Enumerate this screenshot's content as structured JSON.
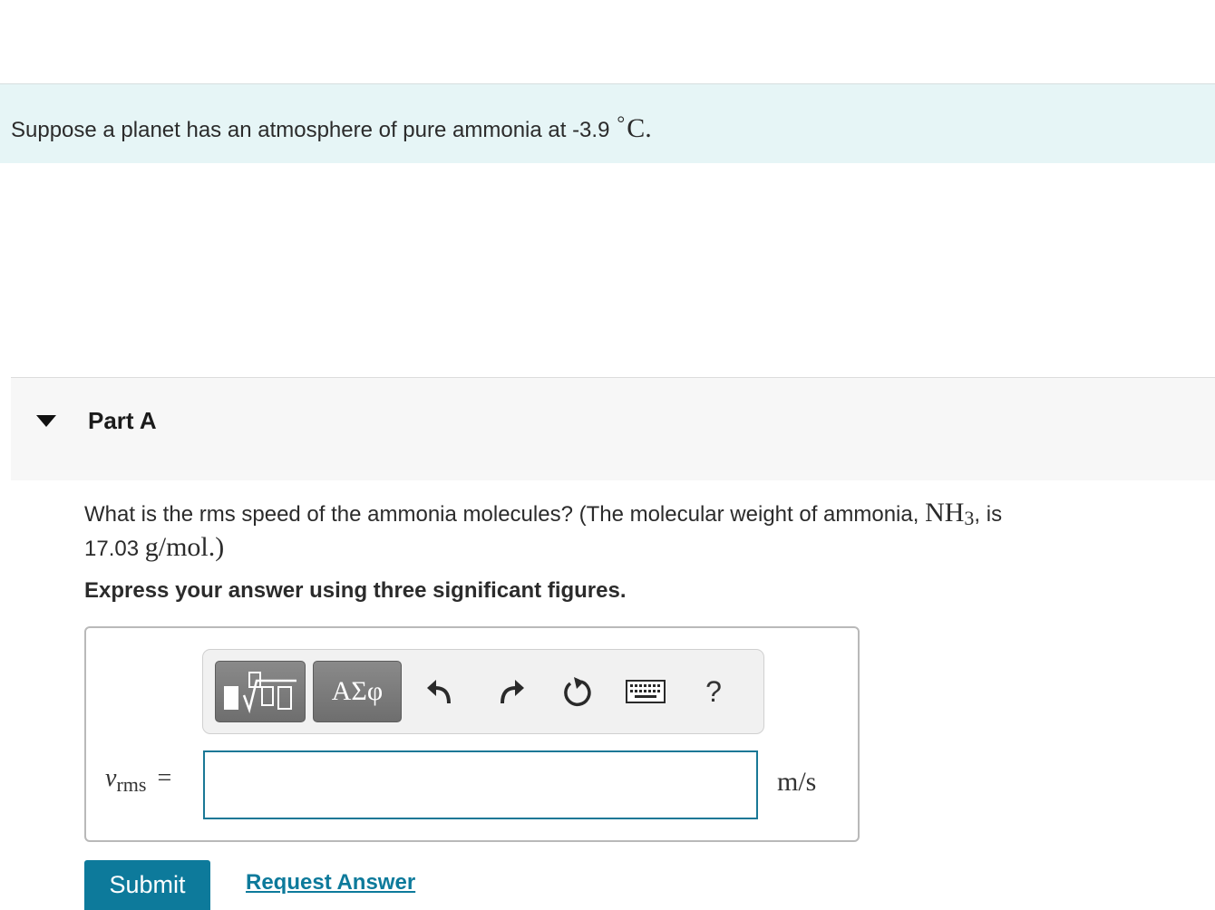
{
  "intro": {
    "text": "Suppose a planet has an atmosphere of pure ammonia at -3.9",
    "degree_symbol": "°",
    "unit": "C",
    "tail": "."
  },
  "part": {
    "title": "Part A"
  },
  "question": {
    "text_before": "What is the rms speed of the ammonia molecules? (The molecular weight of ammonia,",
    "formula_base": "NH",
    "formula_sub": "3",
    "text_after": ", is",
    "mass_value": "17.03",
    "mass_unit": "g/mol",
    "close": ".)"
  },
  "instruction": "Express your answer using three significant figures.",
  "toolbar": {
    "greek_label": "ΑΣφ",
    "help_label": "?",
    "icons": [
      "templates-icon",
      "undo-icon",
      "redo-icon",
      "reset-icon",
      "keyboard-icon",
      "help-icon"
    ]
  },
  "answer": {
    "variable": "v",
    "subscript": "rms",
    "equals": "=",
    "value": "",
    "units": "m/s"
  },
  "actions": {
    "submit_label": "Submit",
    "request_label": "Request Answer"
  },
  "colors": {
    "accent": "#0d7a9b",
    "intro_bg": "#e6f5f6",
    "part_bg": "#f7f7f7",
    "toolbar_bg": "#f1f1f1"
  }
}
